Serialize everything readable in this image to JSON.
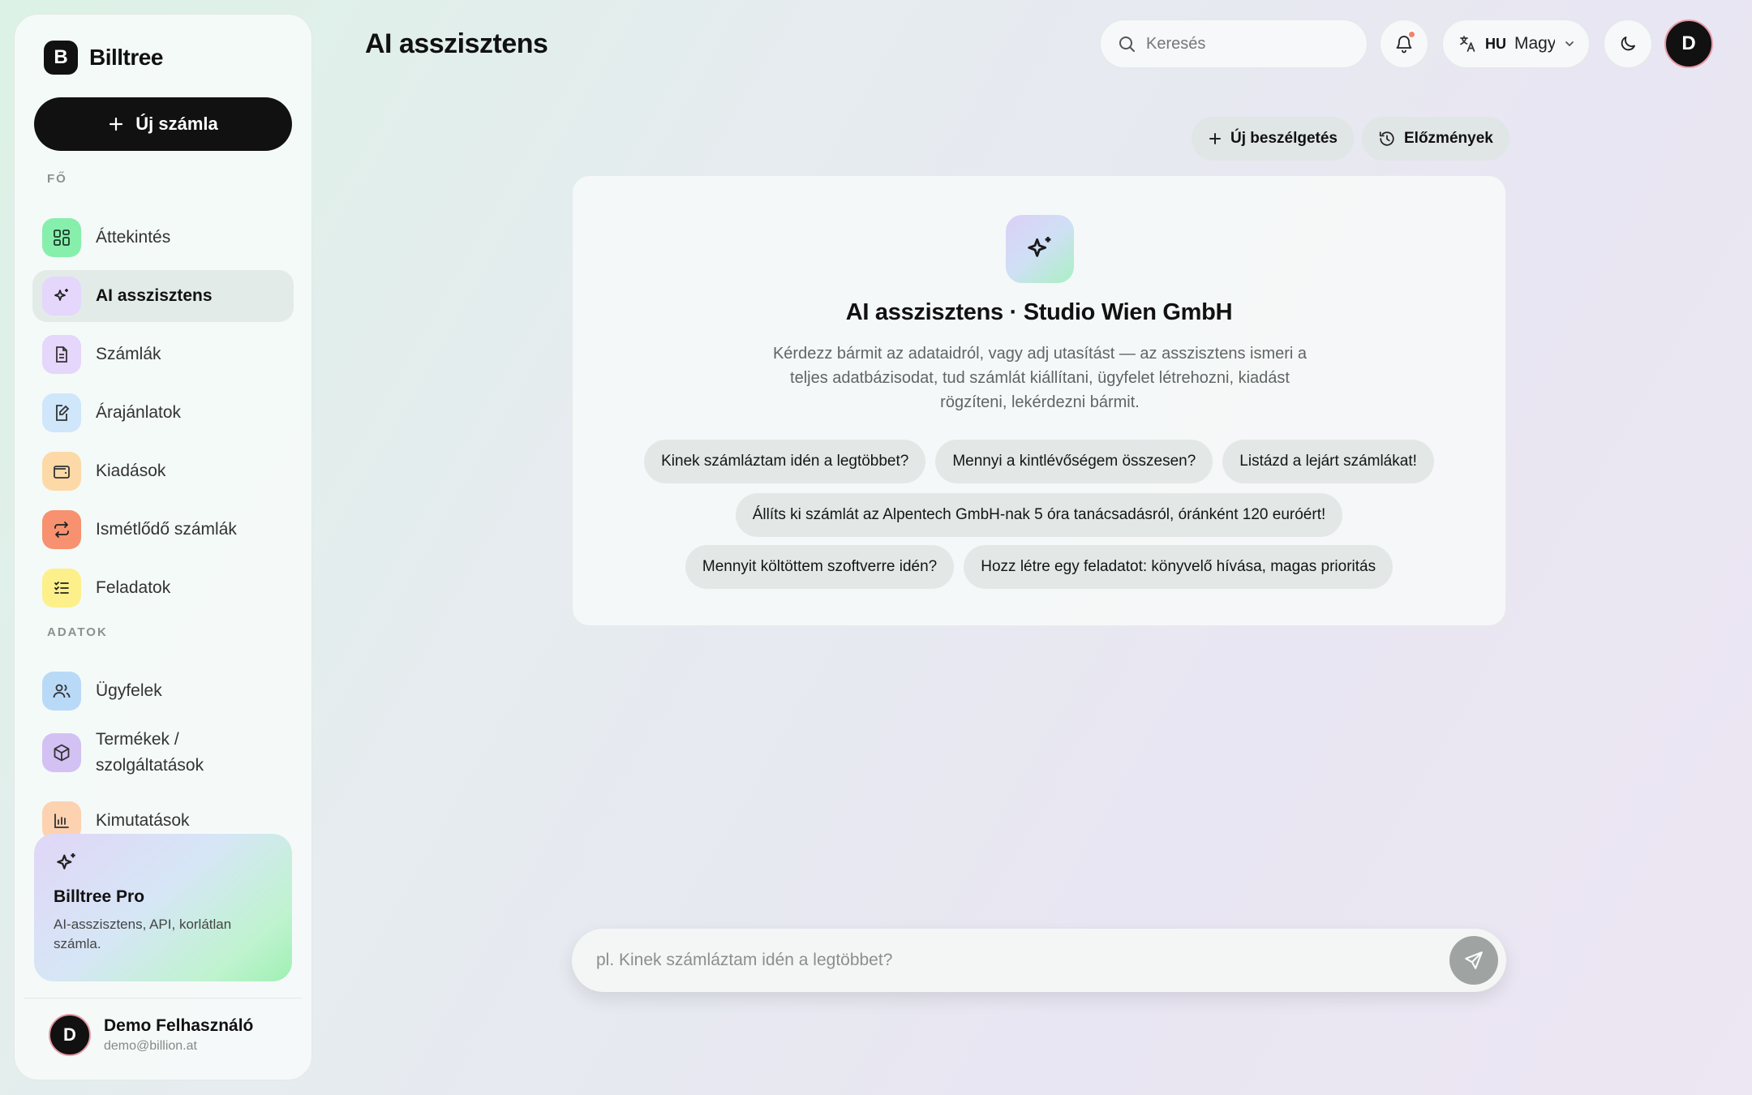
{
  "brand": {
    "logo_letter": "B",
    "name": "Billtree"
  },
  "sidebar": {
    "new_invoice_label": "Új számla",
    "sections": {
      "main": "FŐ",
      "data": "ADATOK"
    },
    "items": [
      {
        "label": "Áttekintés",
        "icon": "dashboard-icon",
        "color": "#7ff0a8"
      },
      {
        "label": "AI asszisztens",
        "icon": "sparkles-icon",
        "color": "#e3d4fa",
        "active": true
      },
      {
        "label": "Számlák",
        "icon": "document-icon",
        "color": "#e3d4fa"
      },
      {
        "label": "Árajánlatok",
        "icon": "edit-document-icon",
        "color": "#cfe6fb"
      },
      {
        "label": "Kiadások",
        "icon": "wallet-icon",
        "color": "#fdd9a8"
      },
      {
        "label": "Ismétlődő számlák",
        "icon": "repeat-icon",
        "color": "#f7916f"
      },
      {
        "label": "Feladatok",
        "icon": "checklist-icon",
        "color": "#fdf08a"
      },
      {
        "label": "Ügyfelek",
        "icon": "users-icon",
        "color": "#b9daf7"
      },
      {
        "label": "Termékek / szolgáltatások",
        "icon": "box-icon",
        "color": "#d3c1f3"
      },
      {
        "label": "Kimutatások",
        "icon": "bar-chart-icon",
        "color": "#fdd2b0"
      }
    ],
    "pro": {
      "title": "Billtree Pro",
      "description": "AI-asszisztens, API, korlátlan számla."
    },
    "user": {
      "initial": "D",
      "name": "Demo Felhasználó",
      "email": "demo@billion.at"
    }
  },
  "header": {
    "title": "AI asszisztens",
    "search_placeholder": "Keresés",
    "language": {
      "code": "HU",
      "name": "Magyar"
    },
    "avatar_initial": "D"
  },
  "chat": {
    "new_conversation_label": "Új beszélgetés",
    "history_label": "Előzmények",
    "hero_title": "AI asszisztens · Studio Wien GmbH",
    "hero_description": "Kérdezz bármit az adataidról, vagy adj utasítást — az asszisztens ismeri a teljes adatbázisodat, tud számlát kiállítani, ügyfelet létrehozni, kiadást rögzíteni, lekérdezni bármit.",
    "suggestions": [
      "Kinek számláztam idén a legtöbbet?",
      "Mennyi a kintlévőségem összesen?",
      "Listázd a lejárt számlákat!",
      "Állíts ki számlát az Alpentech GmbH-nak 5 óra tanácsadásról, óránként 120 euróért!",
      "Mennyit költöttem szoftverre idén?",
      "Hozz létre egy feladatot: könyvelő hívása, magas prioritás"
    ],
    "input_placeholder": "pl. Kinek számláztam idén a legtöbbet?"
  }
}
